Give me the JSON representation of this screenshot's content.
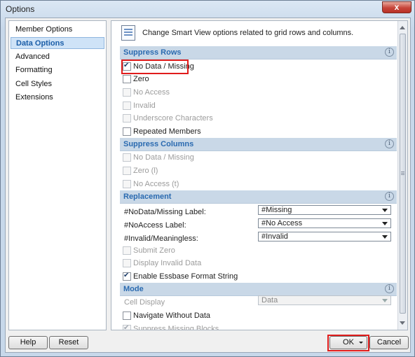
{
  "window": {
    "title": "Options",
    "close_label": "x"
  },
  "sidebar": {
    "items": [
      {
        "label": "Member Options"
      },
      {
        "label": "Data Options",
        "selected": true
      },
      {
        "label": "Advanced"
      },
      {
        "label": "Formatting"
      },
      {
        "label": "Cell Styles"
      },
      {
        "label": "Extensions"
      }
    ]
  },
  "header": {
    "text": "Change Smart View options related to grid rows and columns."
  },
  "sections": {
    "suppress_rows": {
      "title": "Suppress Rows",
      "options": [
        {
          "label": "No Data / Missing",
          "checked": true,
          "enabled": true
        },
        {
          "label": "Zero",
          "checked": false,
          "enabled": true
        },
        {
          "label": "No Access",
          "checked": false,
          "enabled": false
        },
        {
          "label": "Invalid",
          "checked": false,
          "enabled": false
        },
        {
          "label": "Underscore Characters",
          "checked": false,
          "enabled": false
        },
        {
          "label": "Repeated Members",
          "checked": false,
          "enabled": true
        }
      ]
    },
    "suppress_columns": {
      "title": "Suppress Columns",
      "options": [
        {
          "label": "No Data / Missing",
          "checked": false,
          "enabled": false
        },
        {
          "label": "Zero (l)",
          "checked": false,
          "enabled": false
        },
        {
          "label": "No Access (t)",
          "checked": false,
          "enabled": false
        }
      ]
    },
    "replacement": {
      "title": "Replacement",
      "fields": [
        {
          "label": "#NoData/Missing Label:",
          "value": "#Missing"
        },
        {
          "label": "#NoAccess Label:",
          "value": "#No Access"
        },
        {
          "label": "#Invalid/Meaningless:",
          "value": "#Invalid"
        }
      ],
      "options": [
        {
          "label": "Submit Zero",
          "checked": false,
          "enabled": false
        },
        {
          "label": "Display Invalid Data",
          "checked": false,
          "enabled": false
        },
        {
          "label": "Enable Essbase Format String",
          "checked": true,
          "enabled": true
        }
      ]
    },
    "mode": {
      "title": "Mode",
      "cell_display_label": "Cell Display",
      "cell_display_value": "Data",
      "options": [
        {
          "label": "Navigate Without Data",
          "checked": false,
          "enabled": true
        },
        {
          "label": "Suppress Missing Blocks",
          "checked": true,
          "enabled": false
        }
      ]
    }
  },
  "info_glyph": "i",
  "buttons": {
    "help": "Help",
    "reset": "Reset",
    "ok": "OK",
    "cancel": "Cancel"
  }
}
